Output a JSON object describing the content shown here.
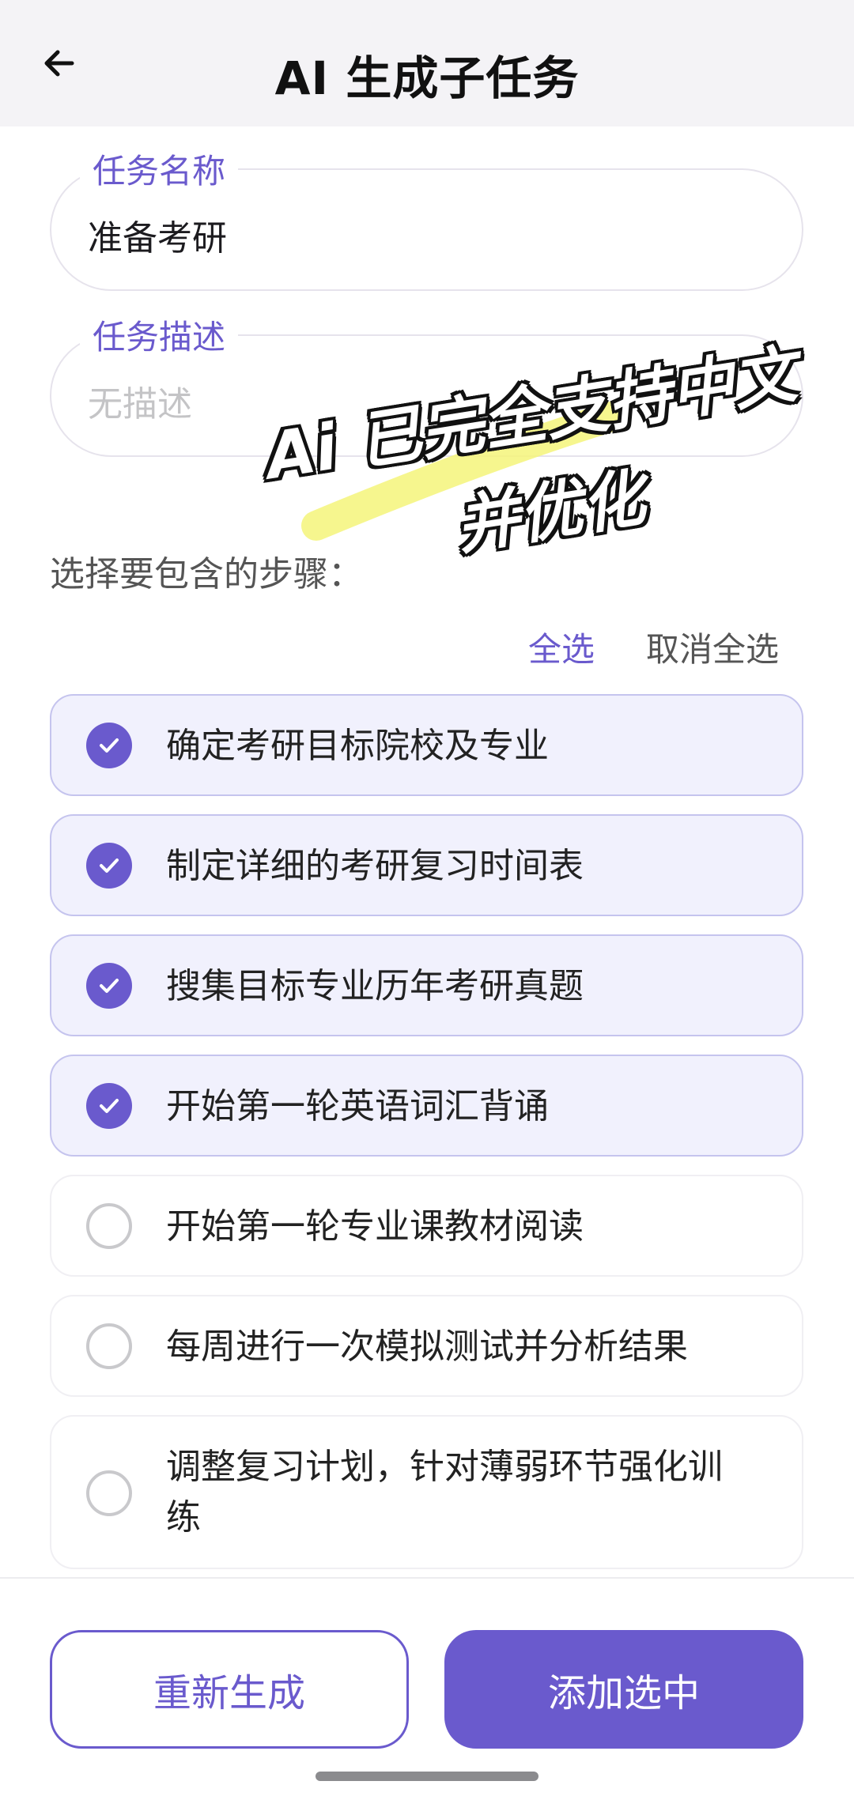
{
  "header": {
    "title": "AI 生成子任务",
    "back_icon": "arrow-left-icon"
  },
  "task_name": {
    "label": "任务名称",
    "value": "准备考研"
  },
  "task_description": {
    "label": "任务描述",
    "placeholder": "无描述"
  },
  "steps_section": {
    "label": "选择要包含的步骤：",
    "select_all": "全选",
    "deselect_all": "取消全选",
    "items": [
      {
        "text": "确定考研目标院校及专业",
        "checked": true
      },
      {
        "text": "制定详细的考研复习时间表",
        "checked": true
      },
      {
        "text": "搜集目标专业历年考研真题",
        "checked": true
      },
      {
        "text": "开始第一轮英语词汇背诵",
        "checked": true
      },
      {
        "text": "开始第一轮专业课教材阅读",
        "checked": false
      },
      {
        "text": "每周进行一次模拟测试并分析结果",
        "checked": false
      },
      {
        "text": "调整复习计划，针对薄弱环节强化训练",
        "checked": false
      }
    ]
  },
  "actions": {
    "regenerate": "重新生成",
    "add_selected": "添加选中"
  },
  "overlay": {
    "line1": "Ai 已完全支持中文",
    "line2": "并优化"
  },
  "colors": {
    "accent": "#6a5acd",
    "checked_bg": "#f1f1fd",
    "header_bg": "#f4f3f6",
    "highlight": "#f4f57a"
  }
}
